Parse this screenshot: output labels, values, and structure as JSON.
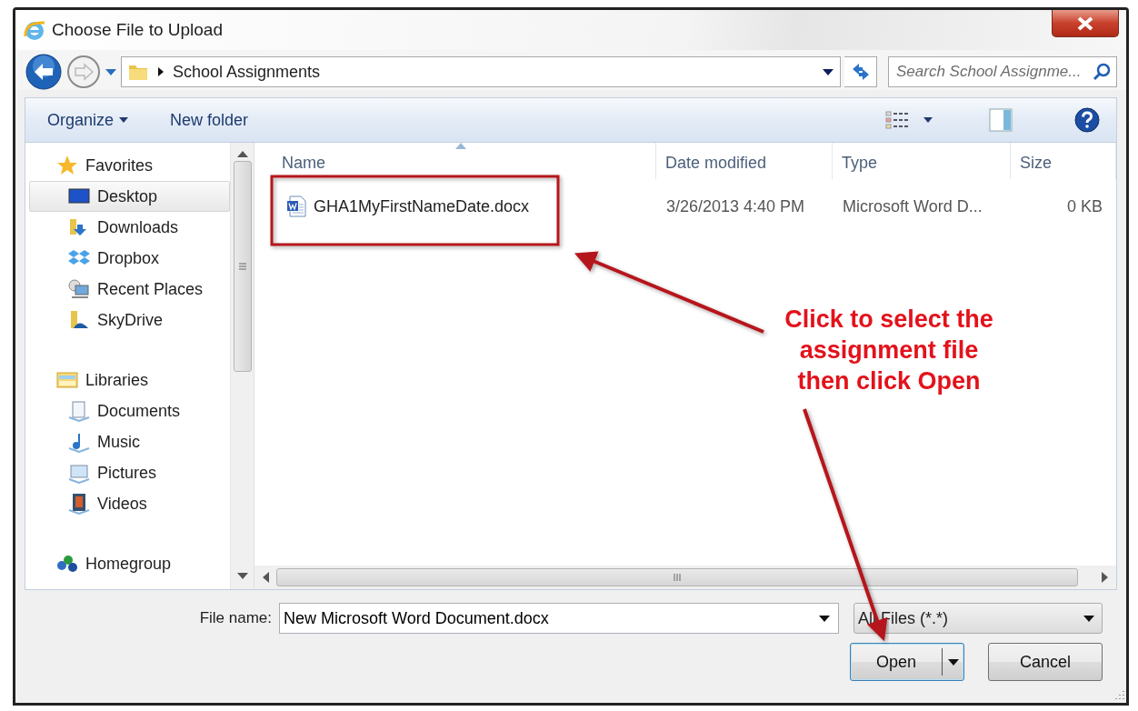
{
  "window": {
    "title": "Choose File to Upload"
  },
  "address_bar": {
    "path": "School Assignments",
    "search_placeholder": "Search School Assignme..."
  },
  "toolbar": [
    {
      "label": "Organize",
      "kind": "menu"
    },
    {
      "label": "New folder",
      "kind": "button"
    }
  ],
  "sidebar": [
    {
      "label": "Favorites",
      "children": [
        {
          "label": "Desktop",
          "selected": true
        },
        {
          "label": "Downloads",
          "selected": false
        },
        {
          "label": "Dropbox",
          "selected": false
        },
        {
          "label": "Recent Places",
          "selected": false
        },
        {
          "label": "SkyDrive",
          "selected": false
        }
      ]
    },
    {
      "label": "Libraries",
      "children": [
        {
          "label": "Documents",
          "selected": false
        },
        {
          "label": "Music",
          "selected": false
        },
        {
          "label": "Pictures",
          "selected": false
        },
        {
          "label": "Videos",
          "selected": false
        }
      ]
    },
    {
      "label": "Homegroup"
    }
  ],
  "file_list": {
    "columns": [
      {
        "label": "Name",
        "sorted": true
      },
      {
        "label": "Date modified",
        "sorted": false
      },
      {
        "label": "Type",
        "sorted": false
      },
      {
        "label": "Size",
        "sorted": false
      }
    ],
    "rows": [
      {
        "name": "GHA1MyFirstNameDate.docx",
        "date_modified": "3/26/2013 4:40 PM",
        "type": "Microsoft Word D...",
        "size": "0 KB",
        "selected": false
      }
    ]
  },
  "file_name": {
    "label": "File name:",
    "value": "New Microsoft Word Document.docx"
  },
  "file_type": {
    "value": "All Files (*.*)"
  },
  "buttons": [
    {
      "label": "Open",
      "kind": "split",
      "default": true
    },
    {
      "label": "Cancel",
      "kind": "plain",
      "default": false
    }
  ],
  "annotation": {
    "text": "Click to select the\nassignment file\nthen click Open"
  }
}
